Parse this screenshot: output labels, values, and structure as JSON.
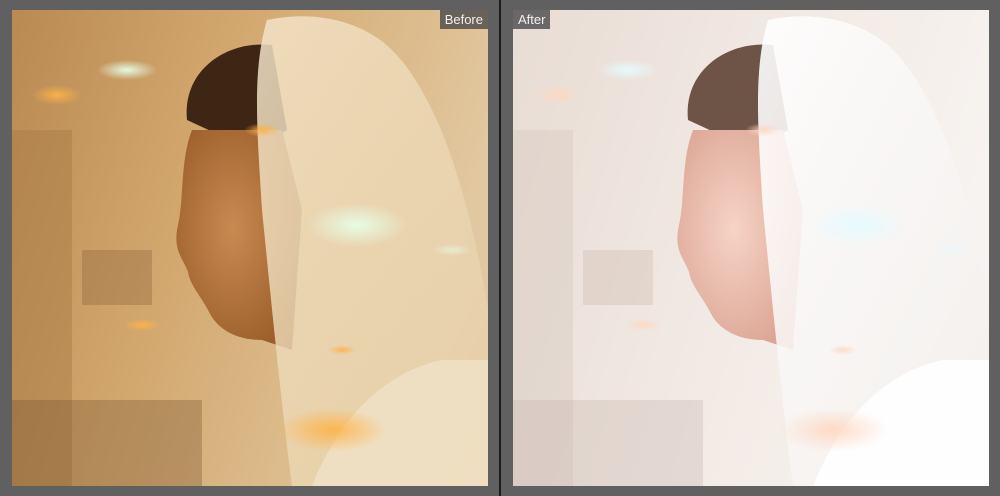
{
  "compare_view": {
    "before_label": "Before",
    "after_label": "After"
  },
  "photo": {
    "subject": "bride-in-veil-profile"
  },
  "colors": {
    "background": "#5f5f5f",
    "divider": "#1c1c1c",
    "badge_bg": "#464646",
    "badge_text": "#f2f2f2",
    "before_tone": "#c89a60",
    "after_tone": "#ece3dc"
  }
}
